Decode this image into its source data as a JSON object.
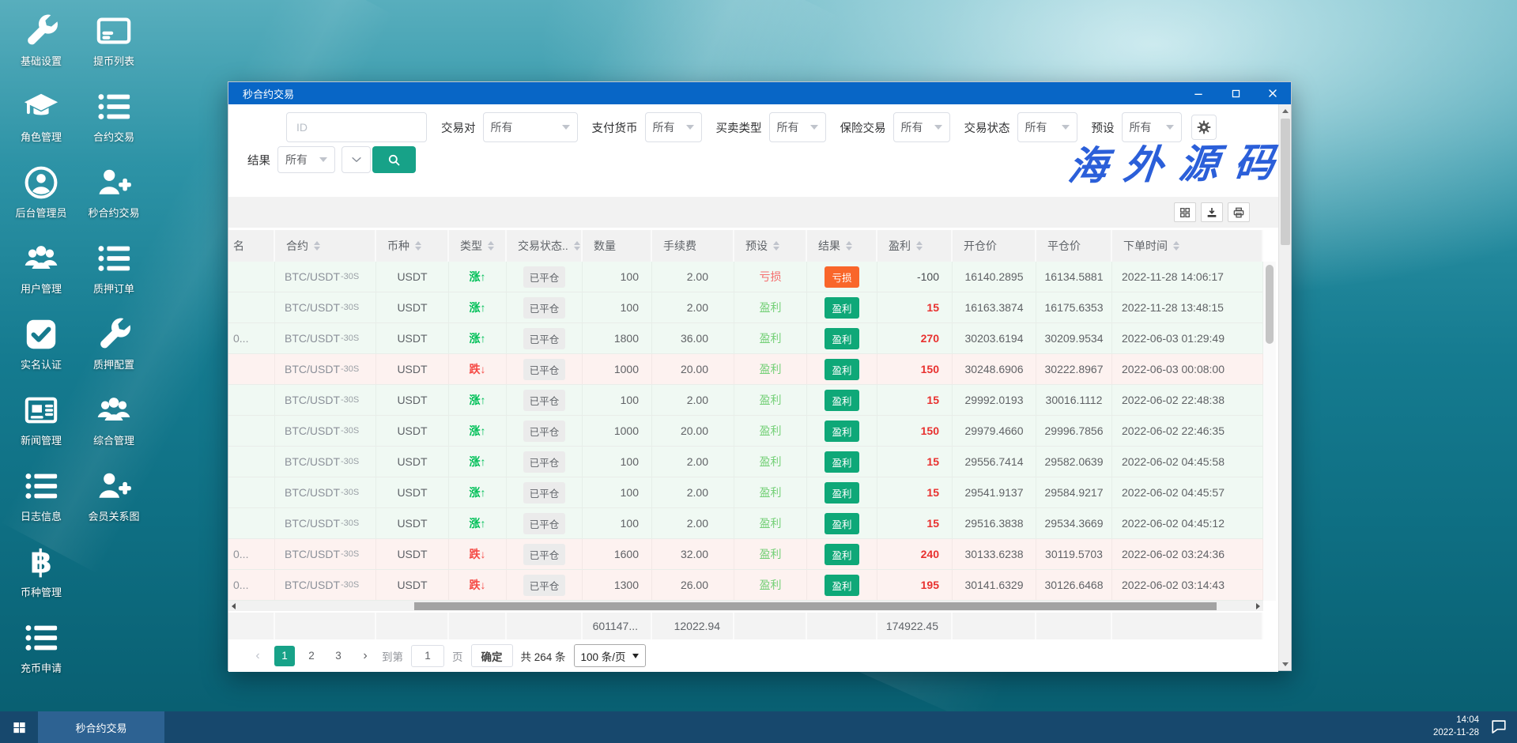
{
  "desktop": {
    "icons": [
      {
        "label": "基础设置",
        "icon": "wrench-icon"
      },
      {
        "label": "提币列表",
        "icon": "card-icon"
      },
      {
        "label": "角色管理",
        "icon": "graduation-cap-icon"
      },
      {
        "label": "合约交易",
        "icon": "list-icon"
      },
      {
        "label": "后台管理员",
        "icon": "admin-user-icon"
      },
      {
        "label": "秒合约交易",
        "icon": "user-plus-icon"
      },
      {
        "label": "用户管理",
        "icon": "users-icon"
      },
      {
        "label": "质押订单",
        "icon": "list-icon"
      },
      {
        "label": "实名认证",
        "icon": "check-square-icon"
      },
      {
        "label": "质押配置",
        "icon": "wrench-icon"
      },
      {
        "label": "新闻管理",
        "icon": "newspaper-icon"
      },
      {
        "label": "综合管理",
        "icon": "users-icon"
      },
      {
        "label": "日志信息",
        "icon": "list-icon"
      },
      {
        "label": "会员关系图",
        "icon": "user-plus-icon"
      },
      {
        "label": "币种管理",
        "icon": "bitcoin-icon"
      },
      {
        "label": "充币申请",
        "icon": "list-icon"
      }
    ]
  },
  "watermark": "海外源码",
  "window": {
    "title": "秒合约交易",
    "filters": {
      "id_placeholder": "ID",
      "row1": [
        {
          "label": "交易对",
          "value": "所有"
        },
        {
          "label": "支付货币",
          "value": "所有"
        },
        {
          "label": "买卖类型",
          "value": "所有"
        },
        {
          "label": "保险交易",
          "value": "所有"
        },
        {
          "label": "交易状态",
          "value": "所有"
        },
        {
          "label": "预设",
          "value": "所有"
        }
      ],
      "result_label": "结果",
      "result_value": "所有"
    },
    "table": {
      "headers": [
        {
          "label": "名",
          "sortable": false
        },
        {
          "label": "合约",
          "sortable": true
        },
        {
          "label": "币种",
          "sortable": true
        },
        {
          "label": "类型",
          "sortable": true
        },
        {
          "label": "交易状态..",
          "sortable": true
        },
        {
          "label": "数量",
          "sortable": false
        },
        {
          "label": "手续费",
          "sortable": false
        },
        {
          "label": "预设",
          "sortable": true
        },
        {
          "label": "结果",
          "sortable": true
        },
        {
          "label": "盈利",
          "sortable": true
        },
        {
          "label": "开仓价",
          "sortable": false
        },
        {
          "label": "平仓价",
          "sortable": false
        },
        {
          "label": "下单时间",
          "sortable": true
        }
      ],
      "rows": [
        {
          "user": "",
          "contract": "BTC/USDT",
          "suffix": "-30S",
          "coin": "USDT",
          "type": "涨",
          "direction": "up",
          "status": "已平仓",
          "quantity": "100",
          "fee": "2.00",
          "preset": "亏损",
          "preset_kind": "loss",
          "result": "亏损",
          "result_kind": "loss",
          "profit": "-100",
          "open": "16140.2895",
          "close": "16134.5881",
          "time": "2022-11-28 14:06:17"
        },
        {
          "user": "",
          "contract": "BTC/USDT",
          "suffix": "-30S",
          "coin": "USDT",
          "type": "涨",
          "direction": "up",
          "status": "已平仓",
          "quantity": "100",
          "fee": "2.00",
          "preset": "盈利",
          "preset_kind": "win",
          "result": "盈利",
          "result_kind": "win",
          "profit": "15",
          "open": "16163.3874",
          "close": "16175.6353",
          "time": "2022-11-28 13:48:15"
        },
        {
          "user": "0...",
          "contract": "BTC/USDT",
          "suffix": "-30S",
          "coin": "USDT",
          "type": "涨",
          "direction": "up",
          "status": "已平仓",
          "quantity": "1800",
          "fee": "36.00",
          "preset": "盈利",
          "preset_kind": "win",
          "result": "盈利",
          "result_kind": "win",
          "profit": "270",
          "open": "30203.6194",
          "close": "30209.9534",
          "time": "2022-06-03 01:29:49"
        },
        {
          "user": "",
          "contract": "BTC/USDT",
          "suffix": "-30S",
          "coin": "USDT",
          "type": "跌",
          "direction": "down",
          "status": "已平仓",
          "quantity": "1000",
          "fee": "20.00",
          "preset": "盈利",
          "preset_kind": "win",
          "result": "盈利",
          "result_kind": "win",
          "profit": "150",
          "open": "30248.6906",
          "close": "30222.8967",
          "time": "2022-06-03 00:08:00"
        },
        {
          "user": "",
          "contract": "BTC/USDT",
          "suffix": "-30S",
          "coin": "USDT",
          "type": "涨",
          "direction": "up",
          "status": "已平仓",
          "quantity": "100",
          "fee": "2.00",
          "preset": "盈利",
          "preset_kind": "win",
          "result": "盈利",
          "result_kind": "win",
          "profit": "15",
          "open": "29992.0193",
          "close": "30016.1112",
          "time": "2022-06-02 22:48:38"
        },
        {
          "user": "",
          "contract": "BTC/USDT",
          "suffix": "-30S",
          "coin": "USDT",
          "type": "涨",
          "direction": "up",
          "status": "已平仓",
          "quantity": "1000",
          "fee": "20.00",
          "preset": "盈利",
          "preset_kind": "win",
          "result": "盈利",
          "result_kind": "win",
          "profit": "150",
          "open": "29979.4660",
          "close": "29996.7856",
          "time": "2022-06-02 22:46:35"
        },
        {
          "user": "",
          "contract": "BTC/USDT",
          "suffix": "-30S",
          "coin": "USDT",
          "type": "涨",
          "direction": "up",
          "status": "已平仓",
          "quantity": "100",
          "fee": "2.00",
          "preset": "盈利",
          "preset_kind": "win",
          "result": "盈利",
          "result_kind": "win",
          "profit": "15",
          "open": "29556.7414",
          "close": "29582.0639",
          "time": "2022-06-02 04:45:58"
        },
        {
          "user": "",
          "contract": "BTC/USDT",
          "suffix": "-30S",
          "coin": "USDT",
          "type": "涨",
          "direction": "up",
          "status": "已平仓",
          "quantity": "100",
          "fee": "2.00",
          "preset": "盈利",
          "preset_kind": "win",
          "result": "盈利",
          "result_kind": "win",
          "profit": "15",
          "open": "29541.9137",
          "close": "29584.9217",
          "time": "2022-06-02 04:45:57"
        },
        {
          "user": "",
          "contract": "BTC/USDT",
          "suffix": "-30S",
          "coin": "USDT",
          "type": "涨",
          "direction": "up",
          "status": "已平仓",
          "quantity": "100",
          "fee": "2.00",
          "preset": "盈利",
          "preset_kind": "win",
          "result": "盈利",
          "result_kind": "win",
          "profit": "15",
          "open": "29516.3838",
          "close": "29534.3669",
          "time": "2022-06-02 04:45:12"
        },
        {
          "user": "0...",
          "contract": "BTC/USDT",
          "suffix": "-30S",
          "coin": "USDT",
          "type": "跌",
          "direction": "down",
          "status": "已平仓",
          "quantity": "1600",
          "fee": "32.00",
          "preset": "盈利",
          "preset_kind": "win",
          "result": "盈利",
          "result_kind": "win",
          "profit": "240",
          "open": "30133.6238",
          "close": "30119.5703",
          "time": "2022-06-02 03:24:36"
        },
        {
          "user": "0...",
          "contract": "BTC/USDT",
          "suffix": "-30S",
          "coin": "USDT",
          "type": "跌",
          "direction": "down",
          "status": "已平仓",
          "quantity": "1300",
          "fee": "26.00",
          "preset": "盈利",
          "preset_kind": "win",
          "result": "盈利",
          "result_kind": "win",
          "profit": "195",
          "open": "30141.6329",
          "close": "30126.6468",
          "time": "2022-06-02 03:14:43"
        }
      ],
      "summary": {
        "quantity": "601147...",
        "fee": "12022.94",
        "profit": "174922.45"
      }
    },
    "pagination": {
      "prev": "‹",
      "next": "›",
      "pages": [
        "1",
        "2",
        "3"
      ],
      "active_page": "1",
      "goto_label": "到第",
      "goto_value": "1",
      "page_unit": "页",
      "confirm_label": "确定",
      "total_label": "共 264 条",
      "page_size": "100 条/页"
    }
  },
  "taskbar": {
    "task_label": "秒合约交易",
    "time": "14:04",
    "date": "2022-11-28"
  },
  "colors": {
    "title_bar": "#0866c6",
    "accent_teal": "#17a288",
    "badge_win": "#0fa878",
    "badge_loss": "#f9662a",
    "up_green": "#00c058",
    "down_red": "#f54a45",
    "profit_red": "#e8312f",
    "row_up_bg": "#f0f9f3",
    "row_down_bg": "#fdf2f0",
    "watermark_blue": "#2b5fd9"
  }
}
